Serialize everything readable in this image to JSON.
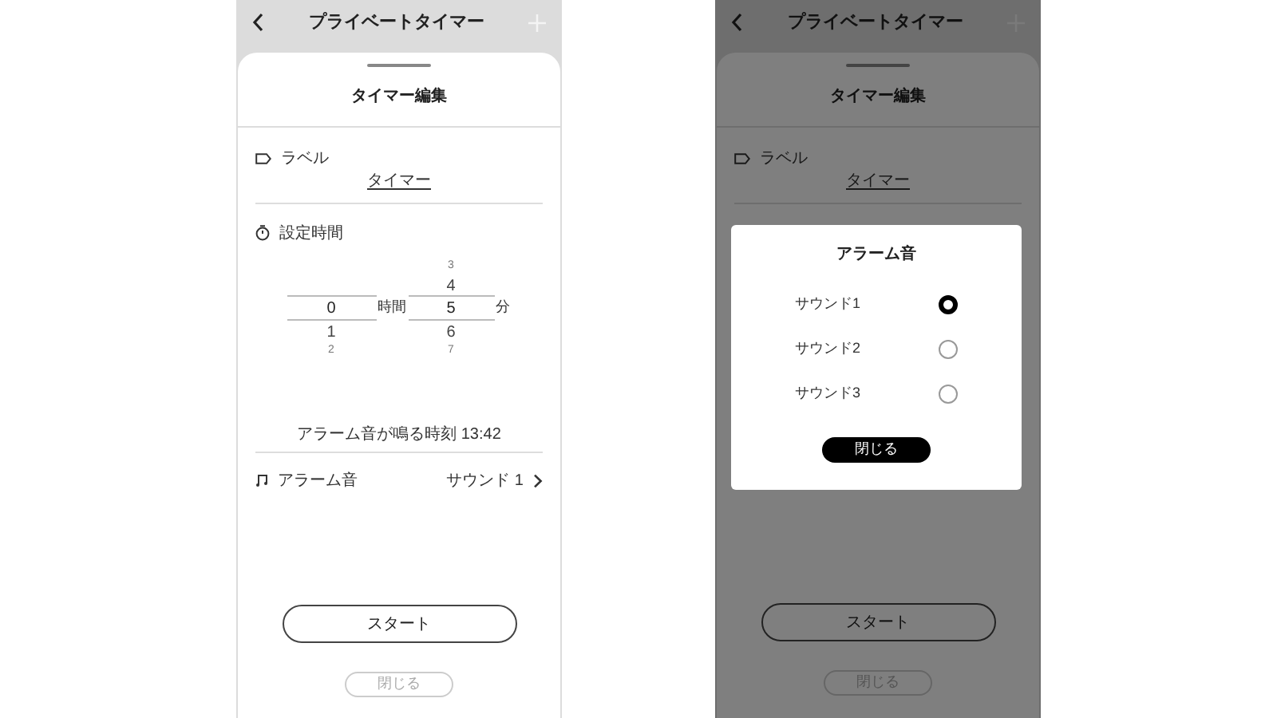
{
  "screens": [
    {
      "header": {
        "title": "プライベートタイマー"
      },
      "sheet": {
        "title": "タイマー編集",
        "label": {
          "caption": "ラベル",
          "value": "タイマー"
        },
        "duration": {
          "caption": "設定時間",
          "columns": [
            {
              "value": "0",
              "below": [
                "1",
                "2"
              ],
              "unit": "時間"
            },
            {
              "above": [
                "3",
                "4"
              ],
              "value": "5",
              "below": [
                "6",
                "7"
              ],
              "unit": "分"
            }
          ],
          "alarm_time": "アラーム音が鳴る時刻 13:42"
        },
        "alarm": {
          "caption": "アラーム音",
          "value": "サウンド 1"
        },
        "start_button": "スタート",
        "close_button": {
          "label": "閉じる",
          "disabled": true
        }
      }
    },
    {
      "header": {
        "title": "プライベートタイマー"
      },
      "sheet": {
        "title": "タイマー編集",
        "label": {
          "caption": "ラベル",
          "value": "タイマー"
        },
        "start_button": "スタート",
        "close_button": {
          "label": "閉じる",
          "disabled": true
        }
      },
      "dialog": {
        "title": "アラーム音",
        "options": [
          {
            "label": "サウンド1",
            "selected": true
          },
          {
            "label": "サウンド2",
            "selected": false
          },
          {
            "label": "サウンド3",
            "selected": false
          }
        ],
        "close_button": "閉じる"
      }
    }
  ]
}
